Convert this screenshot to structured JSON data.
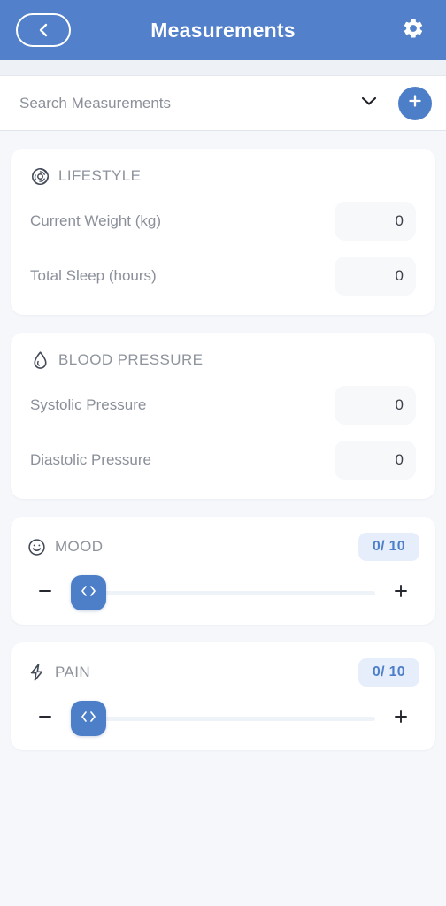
{
  "appbar": {
    "title": "Measurements",
    "back_icon": "chevron-left-icon",
    "settings_icon": "gear-icon"
  },
  "search": {
    "placeholder": "Search Measurements",
    "value": "",
    "dropdown_icon": "chevron-down-icon",
    "add_icon": "plus-icon"
  },
  "colors": {
    "header": "#5280ca",
    "accent": "#4d7fc9",
    "badge_bg": "#e7eefb",
    "page_bg": "#f5f7fb",
    "card_bg": "#ffffff",
    "value_pill_bg": "#f7f8fa"
  },
  "cards": [
    {
      "id": "lifestyle",
      "title": "LIFESTYLE",
      "icon": "pinwheel-icon",
      "type": "fields",
      "fields": [
        {
          "label": "Current Weight (kg)",
          "value": "0"
        },
        {
          "label": "Total Sleep (hours)",
          "value": "0"
        }
      ]
    },
    {
      "id": "blood-pressure",
      "title": "BLOOD PRESSURE",
      "icon": "droplet-icon",
      "type": "fields",
      "fields": [
        {
          "label": "Systolic Pressure",
          "value": "0"
        },
        {
          "label": "Diastolic Pressure",
          "value": "0"
        }
      ]
    },
    {
      "id": "mood",
      "title": "MOOD",
      "icon": "smiley-icon",
      "type": "scale",
      "badge": "0/ 10",
      "value": 0,
      "min": 0,
      "max": 10,
      "decrement_icon": "minus-icon",
      "increment_icon": "plus-icon",
      "thumb_icon": "left-right-chevrons-icon"
    },
    {
      "id": "pain",
      "title": "PAIN",
      "icon": "lightning-bolt-icon",
      "type": "scale",
      "badge": "0/ 10",
      "value": 0,
      "min": 0,
      "max": 10,
      "decrement_icon": "minus-icon",
      "increment_icon": "plus-icon",
      "thumb_icon": "left-right-chevrons-icon"
    }
  ]
}
